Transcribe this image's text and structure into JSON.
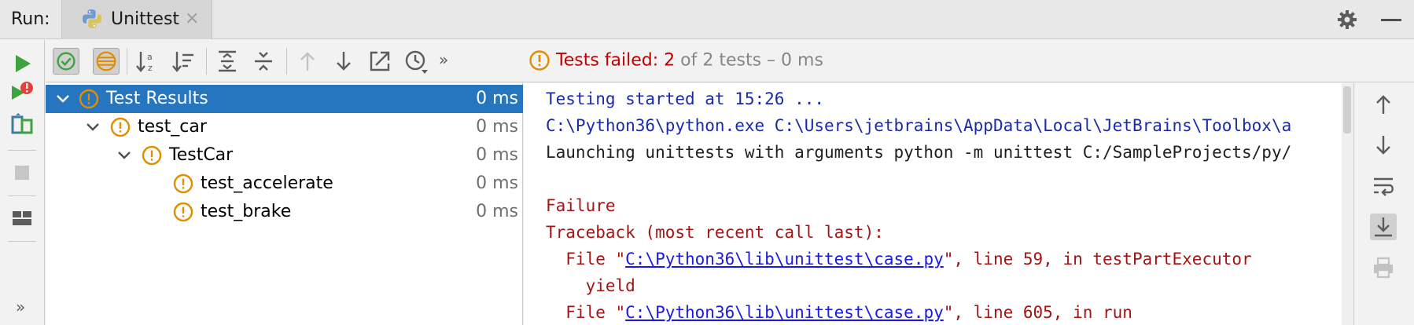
{
  "header": {
    "run_label": "Run:",
    "tab_label": "Unittest",
    "tab_close": "×"
  },
  "icons": {
    "tab": "python-icon",
    "settings": "gear-icon",
    "minimize": "minimize-icon"
  },
  "colors": {
    "selection": "#2675bf",
    "failed": "#c00000",
    "warning": "#e08d00",
    "run_green": "#3ea33e",
    "console_blue": "#1a2aa8",
    "console_red": "#a31515",
    "link": "#1a1ae6"
  },
  "toolbar": {
    "more": "»",
    "status_failed": "Tests failed: 2",
    "status_rest": " of 2 tests – 0 ms"
  },
  "left_strip": {
    "more": "»"
  },
  "tree": {
    "rows": [
      {
        "label": "Test Results",
        "time": "0 ms"
      },
      {
        "label": "test_car",
        "time": "0 ms"
      },
      {
        "label": "TestCar",
        "time": "0 ms"
      },
      {
        "label": "test_accelerate",
        "time": "0 ms"
      },
      {
        "label": "test_brake",
        "time": "0 ms"
      }
    ]
  },
  "console": {
    "line1": "Testing started at 15:26 ...",
    "line2": "C:\\Python36\\python.exe C:\\Users\\jetbrains\\AppData\\Local\\JetBrains\\Toolbox\\a",
    "line3": "Launching unittests with arguments python -m unittest C:/SampleProjects/py/",
    "line5": "Failure",
    "line6": "Traceback (most recent call last):",
    "line7_pre": "  File \"",
    "line7_link": "C:\\Python36\\lib\\unittest\\case.py",
    "line7_post": "\", line 59, in testPartExecutor",
    "line8": "    yield",
    "line9_pre": "  File \"",
    "line9_link": "C:\\Python36\\lib\\unittest\\case.py",
    "line9_post": "\", line 605, in run"
  }
}
